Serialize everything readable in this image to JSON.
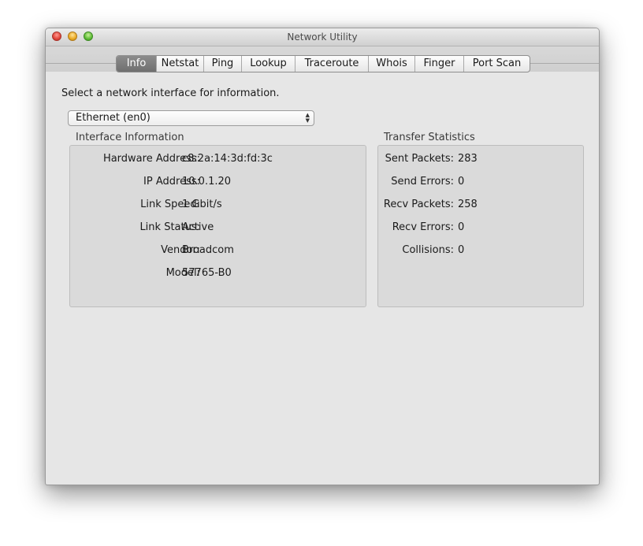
{
  "window": {
    "title": "Network Utility"
  },
  "tabs": [
    {
      "label": "Info",
      "selected": true
    },
    {
      "label": "Netstat",
      "selected": false
    },
    {
      "label": "Ping",
      "selected": false
    },
    {
      "label": "Lookup",
      "selected": false
    },
    {
      "label": "Traceroute",
      "selected": false
    },
    {
      "label": "Whois",
      "selected": false
    },
    {
      "label": "Finger",
      "selected": false
    },
    {
      "label": "Port Scan",
      "selected": false
    }
  ],
  "info": {
    "prompt": "Select a network interface for information.",
    "interface_select": {
      "value": "Ethernet (en0)",
      "icon": "up-down-arrows-icon"
    },
    "interface_information": {
      "title": "Interface Information",
      "rows": [
        {
          "label": "Hardware Address:",
          "value": "c8:2a:14:3d:fd:3c"
        },
        {
          "label": "IP Address:",
          "value": "10.0.1.20"
        },
        {
          "label": "Link Speed:",
          "value": "1 Gbit/s"
        },
        {
          "label": "Link Status:",
          "value": "Active"
        },
        {
          "label": "Vendor:",
          "value": "Broadcom"
        },
        {
          "label": "Model:",
          "value": "57765-B0"
        }
      ]
    },
    "transfer_statistics": {
      "title": "Transfer Statistics",
      "rows": [
        {
          "label": "Sent Packets:",
          "value": "283"
        },
        {
          "label": "Send Errors:",
          "value": "0"
        },
        {
          "label": "Recv Packets:",
          "value": "258"
        },
        {
          "label": "Recv Errors:",
          "value": "0"
        },
        {
          "label": "Collisions:",
          "value": "0"
        }
      ]
    }
  },
  "colors": {
    "window_bg": "#e6e6e6",
    "selected_tab": "#7d7d7d",
    "close_button": "#e0443a",
    "minimize_button": "#e9a923",
    "zoom_button": "#5cbb35"
  }
}
